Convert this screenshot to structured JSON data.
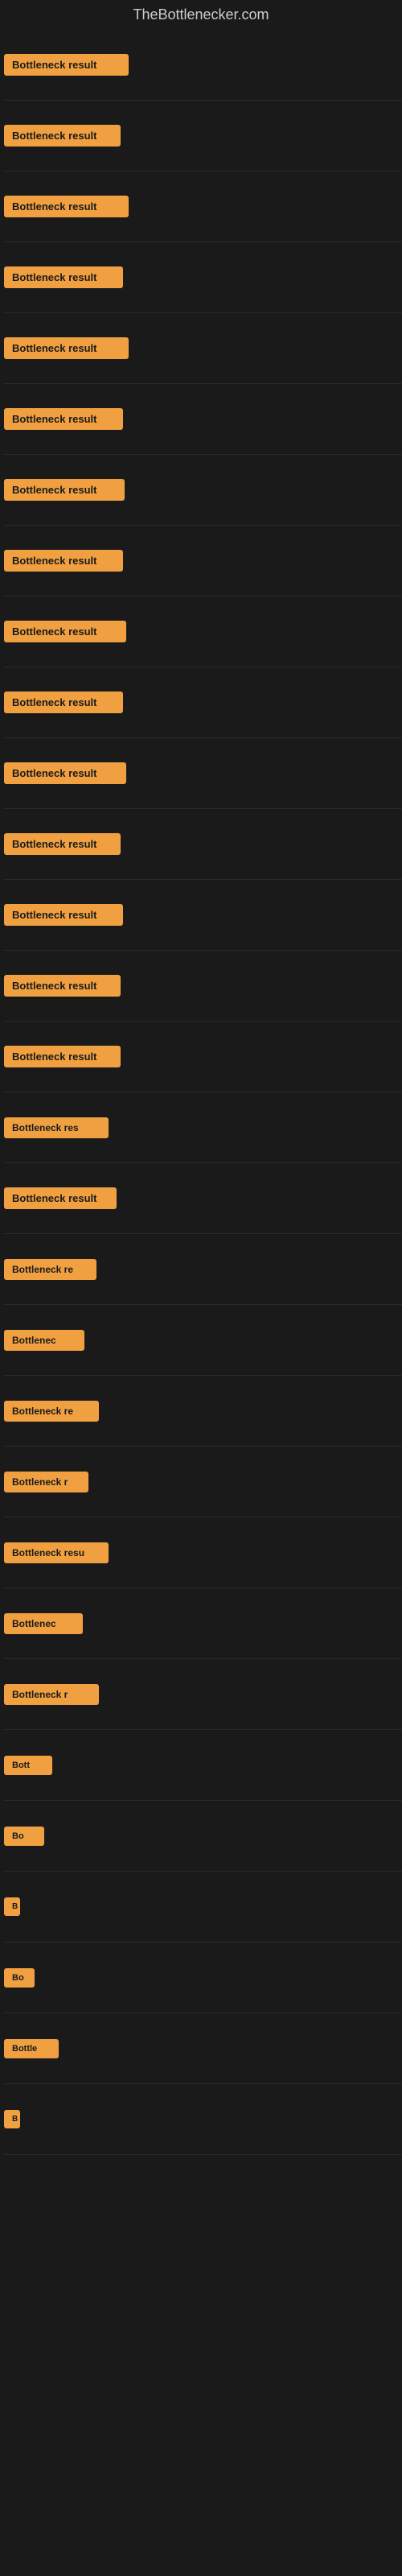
{
  "site": {
    "title": "TheBottlenecker.com"
  },
  "colors": {
    "badge_bg": "#f0a040",
    "page_bg": "#1a1a1a",
    "title_color": "#cccccc"
  },
  "items": [
    {
      "id": 1,
      "label": "Bottleneck result"
    },
    {
      "id": 2,
      "label": "Bottleneck result"
    },
    {
      "id": 3,
      "label": "Bottleneck result"
    },
    {
      "id": 4,
      "label": "Bottleneck result"
    },
    {
      "id": 5,
      "label": "Bottleneck result"
    },
    {
      "id": 6,
      "label": "Bottleneck result"
    },
    {
      "id": 7,
      "label": "Bottleneck result"
    },
    {
      "id": 8,
      "label": "Bottleneck result"
    },
    {
      "id": 9,
      "label": "Bottleneck result"
    },
    {
      "id": 10,
      "label": "Bottleneck result"
    },
    {
      "id": 11,
      "label": "Bottleneck result"
    },
    {
      "id": 12,
      "label": "Bottleneck result"
    },
    {
      "id": 13,
      "label": "Bottleneck result"
    },
    {
      "id": 14,
      "label": "Bottleneck result"
    },
    {
      "id": 15,
      "label": "Bottleneck result"
    },
    {
      "id": 16,
      "label": "Bottleneck res"
    },
    {
      "id": 17,
      "label": "Bottleneck result"
    },
    {
      "id": 18,
      "label": "Bottleneck re"
    },
    {
      "id": 19,
      "label": "Bottlenec"
    },
    {
      "id": 20,
      "label": "Bottleneck re"
    },
    {
      "id": 21,
      "label": "Bottleneck r"
    },
    {
      "id": 22,
      "label": "Bottleneck resu"
    },
    {
      "id": 23,
      "label": "Bottlenec"
    },
    {
      "id": 24,
      "label": "Bottleneck r"
    },
    {
      "id": 25,
      "label": "Bott"
    },
    {
      "id": 26,
      "label": "Bo"
    },
    {
      "id": 27,
      "label": "B"
    },
    {
      "id": 28,
      "label": "Bo"
    },
    {
      "id": 29,
      "label": "Bottle"
    },
    {
      "id": 30,
      "label": "B"
    }
  ]
}
